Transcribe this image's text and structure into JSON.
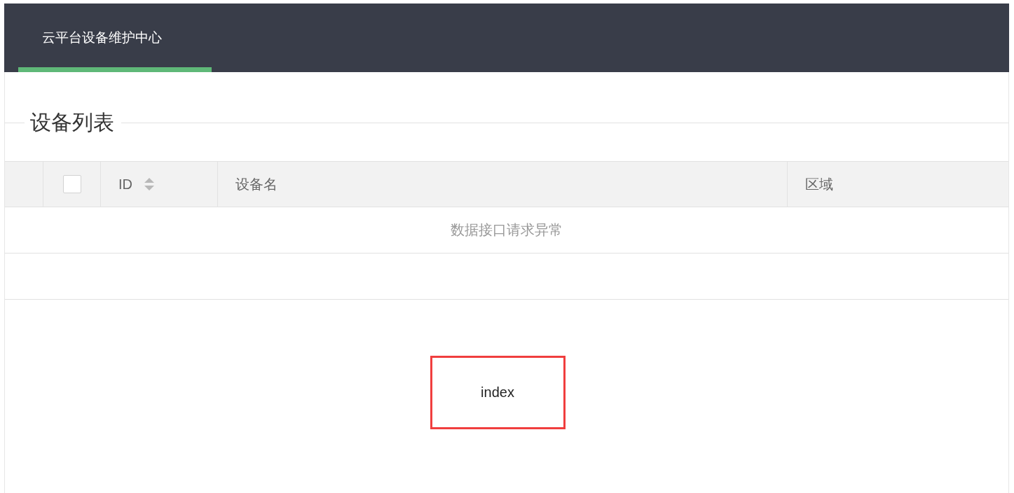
{
  "header": {
    "tabs": [
      {
        "label": "云平台设备维护中心",
        "selected": true
      }
    ]
  },
  "section": {
    "title": "设备列表"
  },
  "table": {
    "columns": [
      {
        "kind": "blank"
      },
      {
        "kind": "checkbox",
        "checked": false
      },
      {
        "kind": "sortable",
        "label": "ID"
      },
      {
        "kind": "text",
        "label": "设备名"
      },
      {
        "kind": "text",
        "label": "区域"
      }
    ],
    "empty_message": "数据接口请求异常"
  },
  "frame": {
    "text": "index"
  }
}
